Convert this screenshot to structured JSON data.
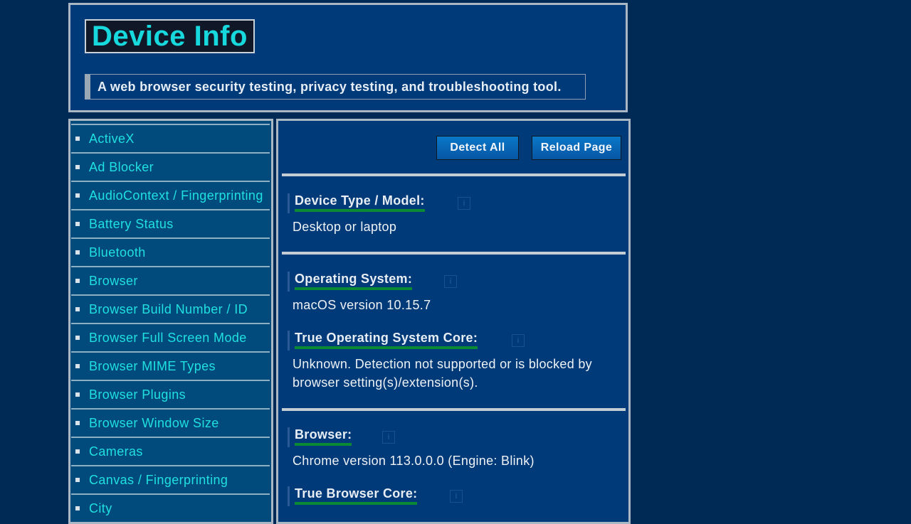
{
  "header": {
    "title": "Device Info",
    "tagline": "A web browser security testing, privacy testing, and troubleshooting tool."
  },
  "sidebar": {
    "items": [
      {
        "label": "ActiveX"
      },
      {
        "label": "Ad Blocker"
      },
      {
        "label": "AudioContext / Fingerprinting"
      },
      {
        "label": "Battery Status"
      },
      {
        "label": "Bluetooth"
      },
      {
        "label": "Browser"
      },
      {
        "label": "Browser Build Number / ID"
      },
      {
        "label": "Browser Full Screen Mode"
      },
      {
        "label": "Browser MIME Types"
      },
      {
        "label": "Browser Plugins"
      },
      {
        "label": "Browser Window Size"
      },
      {
        "label": "Cameras"
      },
      {
        "label": "Canvas / Fingerprinting"
      },
      {
        "label": "City"
      }
    ]
  },
  "toolbar": {
    "detect_all_label": "Detect All",
    "reload_label": "Reload Page"
  },
  "sections": {
    "device_type": {
      "label": "Device Type / Model:",
      "value": "Desktop or laptop"
    },
    "os": {
      "label": "Operating System:",
      "value": "macOS version 10.15.7"
    },
    "true_os_core": {
      "label": "True Operating System Core:",
      "value": "Unknown. Detection not supported or is blocked by browser setting(s)/extension(s)."
    },
    "browser": {
      "label": "Browser:",
      "value": "Chrome version 113.0.0.0 (Engine: Blink)"
    },
    "true_browser_core": {
      "label": "True Browser Core:"
    }
  },
  "icons": {
    "info": "info-icon",
    "bullet": "square-bullet"
  },
  "colors": {
    "background": "#002a56",
    "panel": "#003a78",
    "accent_cyan": "#17d8dc",
    "underline_green": "#0a8a34",
    "button": "#0a78c8"
  }
}
